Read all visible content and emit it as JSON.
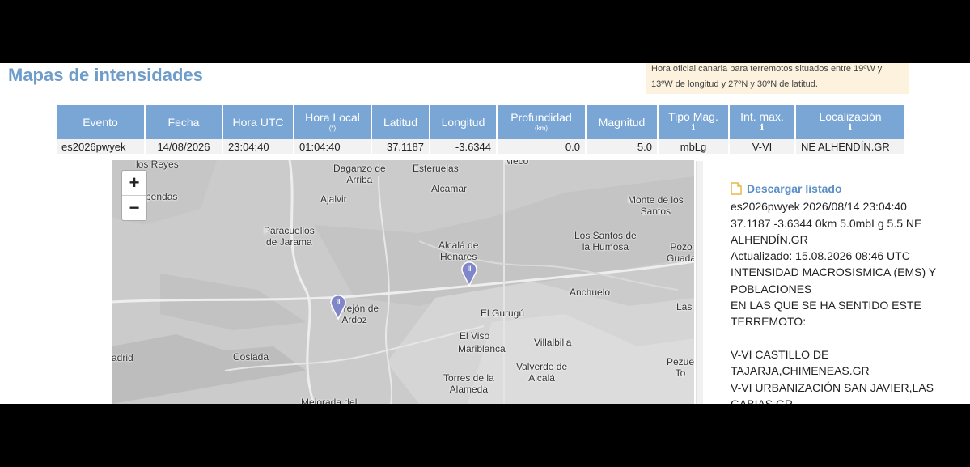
{
  "header": {
    "title": "Mapas de intensidades",
    "notice": "Hora oficial canaria para terremotos situados entre 19ºW y 13ºW de longitud y 27ºN y 30ºN de latitud."
  },
  "table": {
    "columns": {
      "evento": "Evento",
      "fecha": "Fecha",
      "hora_utc": "Hora UTC",
      "hora_local": "Hora Local",
      "hora_local_note": "(*)",
      "latitud": "Latitud",
      "longitud": "Longitud",
      "profundidad": "Profundidad",
      "profundidad_unit": "(km)",
      "magnitud": "Magnitud",
      "tipo_mag": "Tipo Mag.",
      "int_max": "Int. max.",
      "localizacion": "Localización",
      "info_glyph": "ℹ"
    },
    "row": {
      "evento": "es2026pwyek",
      "fecha": "14/08/2026",
      "hora_utc": "23:04:40",
      "hora_local": "01:04:40",
      "latitud": "37.1187",
      "longitud": "-3.6344",
      "profundidad": "0.0",
      "magnitud": "5.0",
      "tipo_mag": "mbLg",
      "int_max": "V-VI",
      "localizacion": "NE ALHENDÍN.GR"
    }
  },
  "map": {
    "zoom_in": "+",
    "zoom_out": "−",
    "pin_label": "II",
    "places": {
      "los_reyes": "los Reyes",
      "daganzo": "Daganzo de\nArriba",
      "esteruelas": "Esteruelas",
      "meco": "Meco",
      "ajalvir": "Ajalvir",
      "alcamar": "Alcamar",
      "monte": "Monte de los\nSantos",
      "pendas": "pendas",
      "paracuellos": "Paracuellos\nde Jarama",
      "los_santos": "Los Santos de\nla Humosa",
      "pozo": "Pozo\nGuada",
      "alcala": "Alcalá de\nHenares",
      "anchuelo": "Anchuelo",
      "torrejon": "Torrejón de\nArdoz",
      "las": "Las",
      "gurugu": "El Gurugú",
      "madrid": "adrid",
      "coslada": "Coslada",
      "elviso": "El Viso",
      "villalbilla": "Villalbilla",
      "mariblanca": "Mariblanca",
      "pezue": "Pezue\nTo",
      "valverde": "Valverde de\nAlcalá",
      "torres": "Torres de la\nAlameda",
      "mejorada": "Mejorada del"
    }
  },
  "side": {
    "download": "Descargar listado",
    "report": "es2026pwyek 2026/08/14 23:04:40 37.1187 -3.6344 0km 5.0mbLg 5.5 NE ALHENDÍN.GR\nActualizado: 15.08.2026 08:46 UTC\nINTENSIDAD MACROSISMICA (EMS) Y POBLACIONES\nEN LAS QUE SE HA SENTIDO ESTE TERREMOTO:\n\nV-VI CASTILLO DE TAJARJA,CHIMENEAS.GR\nV-VI URBANIZACIÓN SAN JAVIER,LAS GABIAS.GR\nV-VI VENTAS DE HUELMA.GR\nV ALHENDÍN.GR"
  },
  "colors": {
    "header_bg": "#7aa6d6",
    "title": "#6f9dc9",
    "link": "#5b8fc7",
    "notice_bg": "#fdf2de",
    "pin": "#7f86c9"
  }
}
